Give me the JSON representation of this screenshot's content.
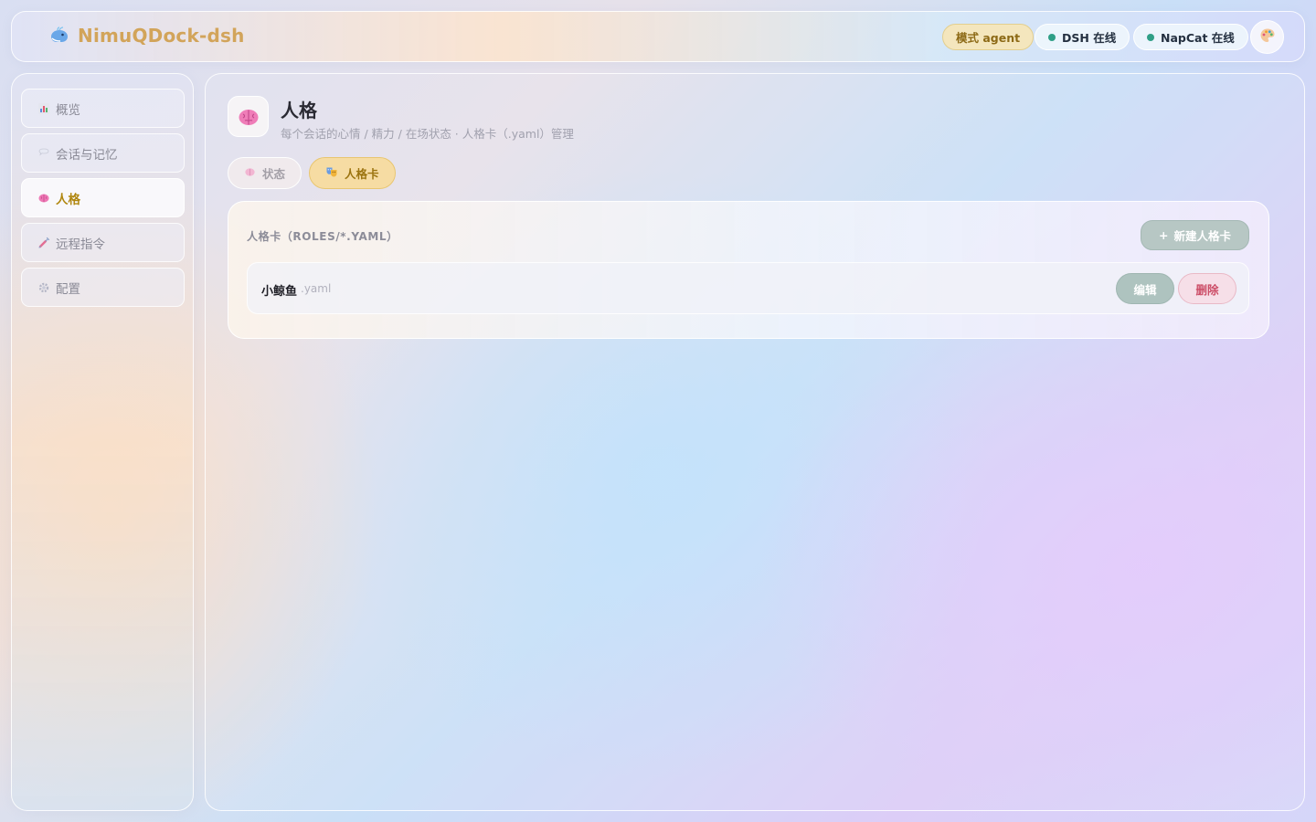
{
  "header": {
    "brand_title": "NimuQDock-dsh",
    "mode_label": "模式 agent",
    "dsh_status": "DSH 在线",
    "napcat_status": "NapCat 在线"
  },
  "sidebar": {
    "items": [
      {
        "label": "概览",
        "icon": "bar-chart-icon"
      },
      {
        "label": "会话与记忆",
        "icon": "speech-bubble-icon"
      },
      {
        "label": "人格",
        "icon": "brain-icon",
        "active": true
      },
      {
        "label": "远程指令",
        "icon": "syringe-icon"
      },
      {
        "label": "配置",
        "icon": "gear-icon"
      }
    ]
  },
  "page": {
    "title": "人格",
    "subtitle": "每个会话的心情 / 精力 / 在场状态 · 人格卡（.yaml）管理"
  },
  "tabs": [
    {
      "label": "状态",
      "icon": "brain-icon"
    },
    {
      "label": "人格卡",
      "icon": "theater-masks-icon",
      "active": true
    }
  ],
  "roles_card": {
    "title": "人格卡（ROLES/*.YAML）",
    "new_button": "新建人格卡",
    "new_button_prefix": "+",
    "rows": [
      {
        "name": "小鲸鱼",
        "ext": ".yaml",
        "edit_label": "编辑",
        "delete_label": "删除"
      }
    ]
  },
  "colors": {
    "brand": "#d2a45a",
    "active_accent": "#b0860e",
    "online_dot": "#2f9f86",
    "danger": "#cc4d67"
  }
}
